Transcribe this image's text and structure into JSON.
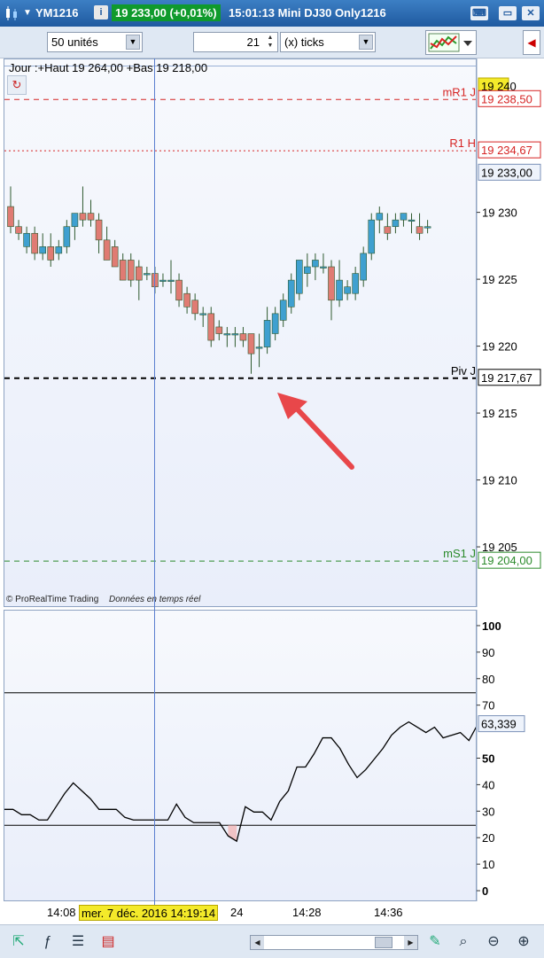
{
  "titlebar": {
    "symbol": "YM1216",
    "price_change": "19 233,00 (+0,01%)",
    "time_title": "15:01:13 Mini DJ30 Only1216",
    "info_icon": "info-icon",
    "colors": {
      "bar": "#1f5aa0",
      "price_bg": "#0f9a2c"
    }
  },
  "toolbar": {
    "units_value": "50 unités",
    "ticks_count": "21",
    "ticks_unit": "(x) ticks"
  },
  "price_panel": {
    "header": "Jour :+Haut 19 264,00 +Bas 19 218,00",
    "copyright": "© ProRealTime Trading",
    "realtime": "Données en temps réel",
    "levels": [
      {
        "label": "mR1 J",
        "value": "19 238,50",
        "price": 19238.5,
        "color": "#d62424",
        "style": "dash"
      },
      {
        "label": "R1 H",
        "value": "19 234,67",
        "price": 19234.67,
        "color": "#d62424",
        "style": "dot"
      },
      {
        "label": "Piv J",
        "value": "19 217,67",
        "price": 19217.67,
        "color": "#000000",
        "style": "dash"
      },
      {
        "label": "mS1 J",
        "value": "19 204,00",
        "price": 19204.0,
        "color": "#2a8a2a",
        "style": "dash"
      }
    ],
    "current_price": "19 233,00",
    "top_label": "19 240",
    "y_ticks": [
      "19 230",
      "19 225",
      "19 220",
      "19 215",
      "19 210",
      "19 205"
    ]
  },
  "indicator_panel": {
    "value_label": "63,339",
    "y_ticks": [
      "100",
      "90",
      "80",
      "70",
      "50",
      "40",
      "30",
      "20",
      "10",
      "0"
    ]
  },
  "x_axis": {
    "crosshair_date": "mer. 7 déc. 2016 14:19:14",
    "labels": [
      "14:08",
      "24",
      "14:28",
      "14:36"
    ]
  },
  "chart_data": {
    "type": "candlestick",
    "candles": [
      [
        19230.5,
        19232.0,
        19228.5,
        19229.0
      ],
      [
        19229.0,
        19229.5,
        19228.0,
        19228.5
      ],
      [
        19227.5,
        19229.0,
        19227.0,
        19228.5
      ],
      [
        19228.5,
        19229.0,
        19226.5,
        19227.0
      ],
      [
        19227.0,
        19228.5,
        19226.5,
        19227.5
      ],
      [
        19227.5,
        19228.5,
        19226.0,
        19226.5
      ],
      [
        19227.0,
        19228.0,
        19226.5,
        19227.5
      ],
      [
        19227.5,
        19229.5,
        19227.0,
        19229.0
      ],
      [
        19229.0,
        19230.0,
        19228.0,
        19230.0
      ],
      [
        19230.0,
        19232.0,
        19229.0,
        19229.5
      ],
      [
        19230.0,
        19231.0,
        19229.0,
        19229.5
      ],
      [
        19229.5,
        19230.0,
        19227.0,
        19228.0
      ],
      [
        19228.0,
        19229.0,
        19226.5,
        19226.5
      ],
      [
        19227.5,
        19228.0,
        19226.0,
        19226.0
      ],
      [
        19226.5,
        19227.0,
        19225.0,
        19225.0
      ],
      [
        19226.5,
        19227.0,
        19224.5,
        19225.0
      ],
      [
        19226.0,
        19226.5,
        19223.5,
        19225.0
      ],
      [
        19225.5,
        19226.0,
        19225.0,
        19225.5
      ],
      [
        19225.5,
        19226.0,
        19224.0,
        19224.5
      ],
      [
        19225.0,
        19225.5,
        19224.5,
        19225.0
      ],
      [
        19225.0,
        19226.5,
        19224.0,
        19225.0
      ],
      [
        19225.0,
        19225.5,
        19223.0,
        19223.5
      ],
      [
        19224.0,
        19224.5,
        19222.5,
        19223.0
      ],
      [
        19223.5,
        19224.0,
        19222.0,
        19222.5
      ],
      [
        19222.5,
        19223.0,
        19221.5,
        19222.5
      ],
      [
        19222.5,
        19223.0,
        19220.0,
        19220.5
      ],
      [
        19221.5,
        19222.0,
        19220.5,
        19221.0
      ],
      [
        19221.0,
        19221.5,
        19220.0,
        19221.0
      ],
      [
        19221.0,
        19221.5,
        19220.0,
        19221.0
      ],
      [
        19221.0,
        19221.5,
        19220.0,
        19220.5
      ],
      [
        19221.0,
        19221.0,
        19218.0,
        19219.5
      ],
      [
        19220.0,
        19221.0,
        19218.5,
        19220.0
      ],
      [
        19220.0,
        19223.0,
        19219.5,
        19222.0
      ],
      [
        19221.0,
        19223.0,
        19220.5,
        19222.5
      ],
      [
        19222.0,
        19224.0,
        19221.5,
        19223.5
      ],
      [
        19223.0,
        19225.5,
        19222.5,
        19225.0
      ],
      [
        19224.0,
        19226.5,
        19223.5,
        19226.5
      ],
      [
        19225.5,
        19227.0,
        19224.5,
        19226.0
      ],
      [
        19226.0,
        19227.0,
        19225.0,
        19226.5
      ],
      [
        19226.0,
        19227.0,
        19225.5,
        19226.0
      ],
      [
        19226.0,
        19226.5,
        19222.0,
        19223.5
      ],
      [
        19223.5,
        19226.5,
        19223.0,
        19225.0
      ],
      [
        19224.0,
        19225.0,
        19223.5,
        19224.5
      ],
      [
        19224.0,
        19226.0,
        19223.5,
        19225.5
      ],
      [
        19225.0,
        19227.5,
        19224.5,
        19227.0
      ],
      [
        19227.0,
        19230.0,
        19226.5,
        19229.5
      ],
      [
        19229.5,
        19230.5,
        19228.5,
        19230.0
      ],
      [
        19229.0,
        19230.0,
        19228.0,
        19228.5
      ],
      [
        19229.0,
        19230.0,
        19228.5,
        19229.5
      ],
      [
        19229.5,
        19230.0,
        19229.0,
        19230.0
      ],
      [
        19229.5,
        19230.0,
        19228.5,
        19229.5
      ],
      [
        19229.0,
        19230.0,
        19228.0,
        19228.5
      ],
      [
        19229.0,
        19229.5,
        19228.5,
        19229.0
      ]
    ],
    "ylim": [
      19200.5,
      19241.5
    ],
    "up_color": "#3fa0d0",
    "down_color": "#e07b73",
    "indicator": {
      "values": [
        31,
        31,
        29,
        29,
        27,
        27,
        32,
        37,
        41,
        38,
        35,
        31,
        31,
        31,
        28,
        27,
        27,
        27,
        27,
        27,
        33,
        28,
        26,
        26,
        26,
        26,
        21,
        19,
        32,
        30,
        30,
        27,
        34,
        38,
        47,
        47,
        52,
        58,
        58,
        54,
        48,
        43,
        46,
        50,
        54,
        59,
        62,
        64,
        62,
        60,
        62,
        58,
        59,
        60,
        57,
        63
      ],
      "ylim": [
        -4,
        106
      ],
      "levels": [
        75,
        25
      ]
    }
  }
}
